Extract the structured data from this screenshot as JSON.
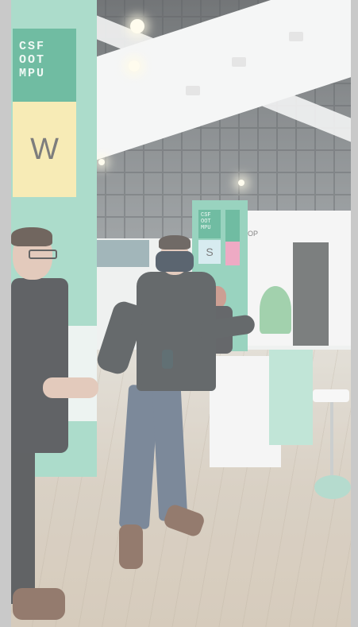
{
  "scene": {
    "booth_logo_text": "CSF OOT MPU",
    "booth_letter_w": "W",
    "pillar_logo_text": "CSF OOT MPU",
    "pillar_letter_s": "S",
    "sign_text": "OP"
  },
  "colors": {
    "booth_green": "#3aa37e",
    "booth_mint": "#8ccfb8",
    "yellow_tile": "#f4e39a",
    "pink_tile": "#e889ad",
    "frame_gray": "#c9c9c9"
  }
}
